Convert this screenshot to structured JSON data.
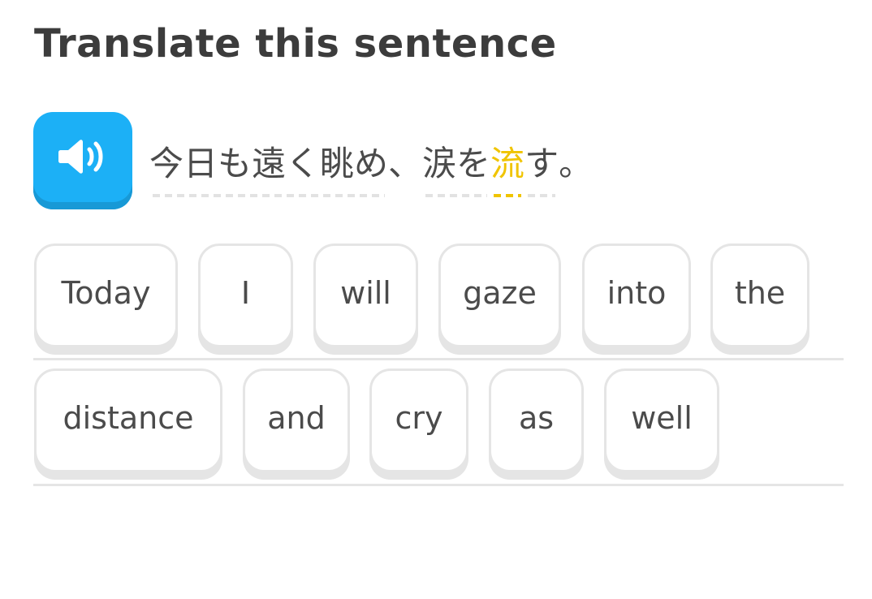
{
  "header": {
    "title": "Translate this sentence"
  },
  "audio": {
    "icon": "speaker-icon",
    "color": "#1cb0f6"
  },
  "prompt": {
    "group1": "今日も遠く眺め",
    "comma": "、",
    "group2a": "涙を",
    "highlight": "流",
    "group2b": "す",
    "period": "。",
    "highlight_color": "#f0c400"
  },
  "word_bank": {
    "row1": [
      "Today",
      "I",
      "will",
      "gaze",
      "into",
      "the"
    ],
    "row2": [
      "distance",
      "and",
      "cry",
      "as",
      "well"
    ]
  }
}
